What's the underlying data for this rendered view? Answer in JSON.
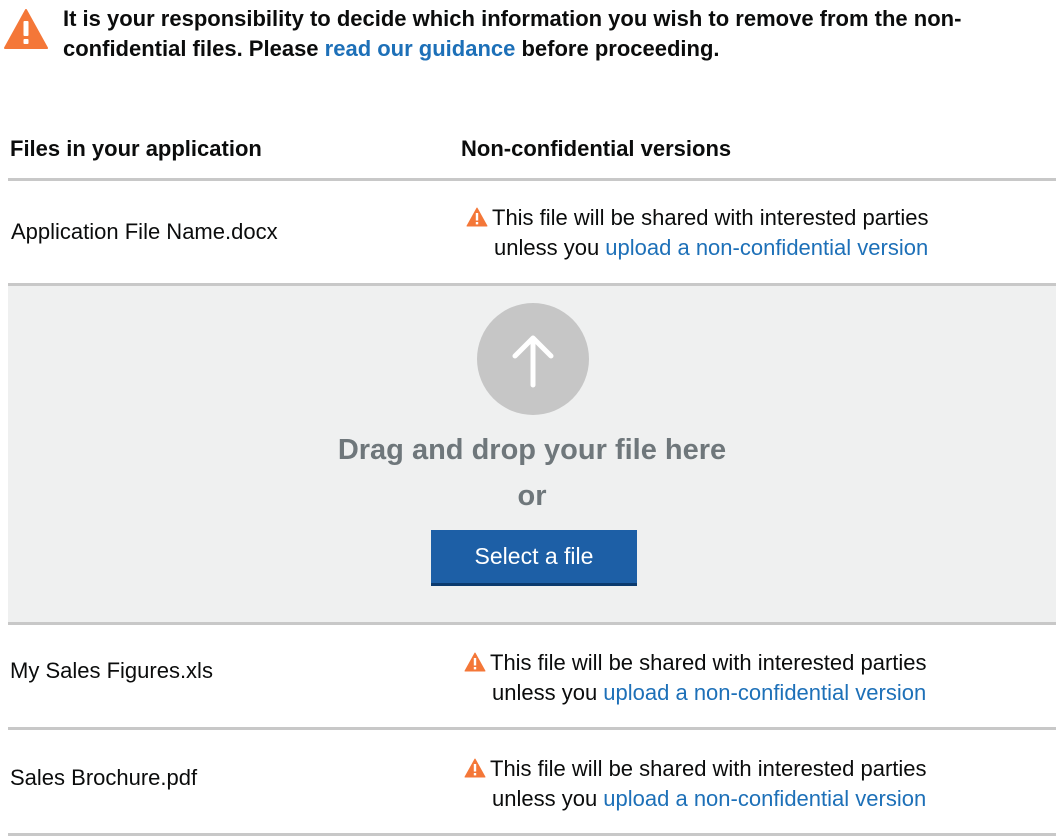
{
  "warning": {
    "icon": "warning-triangle-icon",
    "text_before": "It is your responsibility to decide which information you wish to remove from the non-confidential files. Please ",
    "link": "read our guidance",
    "text_after": " before proceeding."
  },
  "table": {
    "headers": [
      "Files in your application",
      "Non-confidential versions"
    ],
    "rows": [
      {
        "file": "Application File Name.docx",
        "status_line1": "This file will be shared with interested parties",
        "status_prefix": "unless you ",
        "status_link": "upload a non-confidential version"
      },
      {
        "file": "My Sales Figures.xls",
        "status_line1": "This file will be shared with interested parties",
        "status_prefix": "unless you ",
        "status_link": "upload a non-confidential version"
      },
      {
        "file": "Sales Brochure.pdf",
        "status_line1": "This file will be shared with interested parties",
        "status_prefix": "unless you ",
        "status_link": "upload a non-confidential version"
      }
    ]
  },
  "dropzone": {
    "icon": "upload-arrow-icon",
    "title": "Drag and drop your file here",
    "or": "or",
    "button": "Select a file"
  },
  "colors": {
    "link": "#1d70b8",
    "warning": "#f47738",
    "button": "#1d5fa6",
    "dropzone_bg": "#eff0f0"
  }
}
